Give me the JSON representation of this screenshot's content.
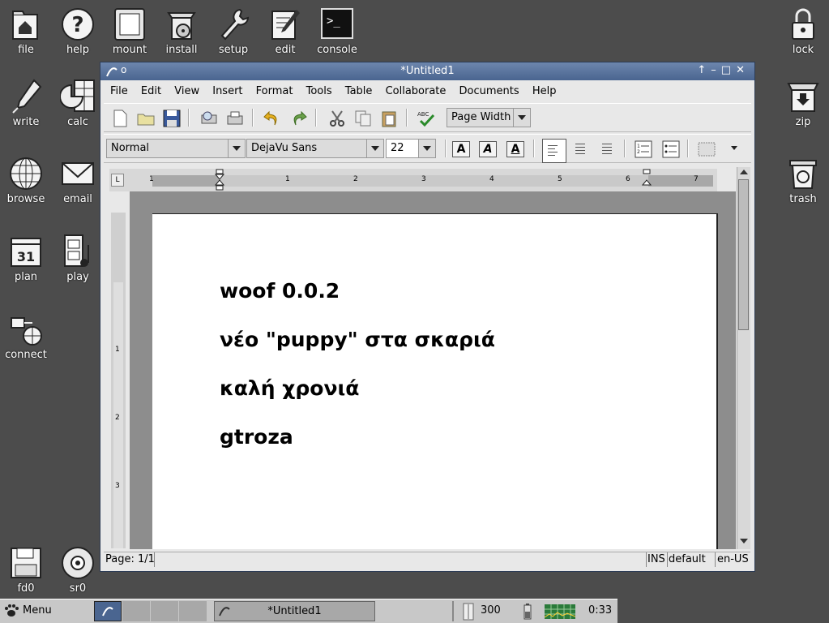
{
  "desktop": {
    "left_icons": [
      {
        "label": "file",
        "icon": "home-folder-icon"
      },
      {
        "label": "help",
        "icon": "question-icon"
      },
      {
        "label": "mount",
        "icon": "drive-icon"
      },
      {
        "label": "install",
        "icon": "install-box-icon"
      },
      {
        "label": "setup",
        "icon": "wrench-icon"
      },
      {
        "label": "edit",
        "icon": "notepad-pen-icon"
      },
      {
        "label": "console",
        "icon": "terminal-icon"
      },
      {
        "label": "write",
        "icon": "fountain-pen-icon"
      },
      {
        "label": "calc",
        "icon": "spreadsheet-chart-icon"
      },
      {
        "label": "browse",
        "icon": "globe-icon"
      },
      {
        "label": "email",
        "icon": "envelope-icon"
      },
      {
        "label": "plan",
        "icon": "calendar-icon"
      },
      {
        "label": "play",
        "icon": "film-music-icon"
      },
      {
        "label": "connect",
        "icon": "network-plug-icon"
      },
      {
        "label": "fd0",
        "icon": "floppy-icon"
      },
      {
        "label": "sr0",
        "icon": "cd-icon"
      }
    ],
    "right_icons": [
      {
        "label": "lock",
        "icon": "padlock-icon"
      },
      {
        "label": "zip",
        "icon": "archive-box-icon"
      },
      {
        "label": "trash",
        "icon": "recycle-bin-icon"
      }
    ]
  },
  "window": {
    "title": "*Untitled1",
    "menu": [
      "File",
      "Edit",
      "View",
      "Insert",
      "Format",
      "Tools",
      "Table",
      "Collaborate",
      "Documents",
      "Help"
    ],
    "toolbar": {
      "zoom": "Page Width"
    },
    "format_bar": {
      "style": "Normal",
      "font": "DejaVu Sans",
      "size": "22"
    },
    "ruler_numbers": [
      "1",
      "1",
      "2",
      "3",
      "4",
      "5",
      "6",
      "7"
    ],
    "vruler_numbers": [
      "1",
      "2",
      "3"
    ],
    "document": {
      "paragraphs": [
        "woof 0.0.2",
        "νέο \"puppy\" στα σκαριά",
        "καλή χρονιά",
        "gtroza"
      ]
    },
    "status": {
      "page": "Page: 1/1",
      "mode": "INS",
      "layout": "default",
      "lang": "en-US"
    }
  },
  "taskbar": {
    "menu_label": "Menu",
    "task_title": "*Untitled1",
    "counter": "300",
    "clock": "0:33"
  },
  "colors": {
    "desktop": "#4c4c4c",
    "titlebar": "#5a739c",
    "page": "#ffffff",
    "docbg": "#8d8d8d"
  }
}
